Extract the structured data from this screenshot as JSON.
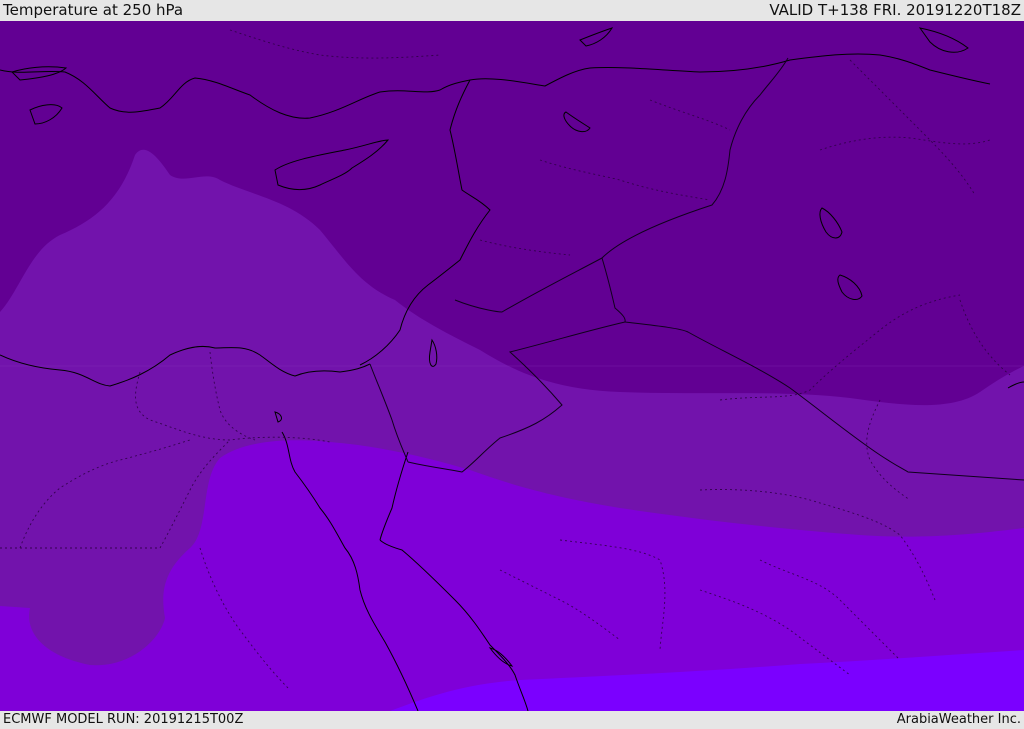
{
  "header": {
    "title": "Temperature at 250 hPa",
    "valid": "VALID T+138 FRI. 20191220T18Z"
  },
  "footer": {
    "model_run": "ECMWF MODEL RUN: 20191215T00Z",
    "credit": "ArabiaWeather Inc."
  },
  "map": {
    "region": "Eastern Mediterranean & Middle East",
    "field": "temperature-250hPa",
    "colors": {
      "band_coldest": "#620093",
      "band_cold": "#7213ac",
      "band_mid": "#7f00d8",
      "band_warm": "#7b00ff",
      "coastline": "#000000",
      "border": "#1a0033"
    }
  }
}
